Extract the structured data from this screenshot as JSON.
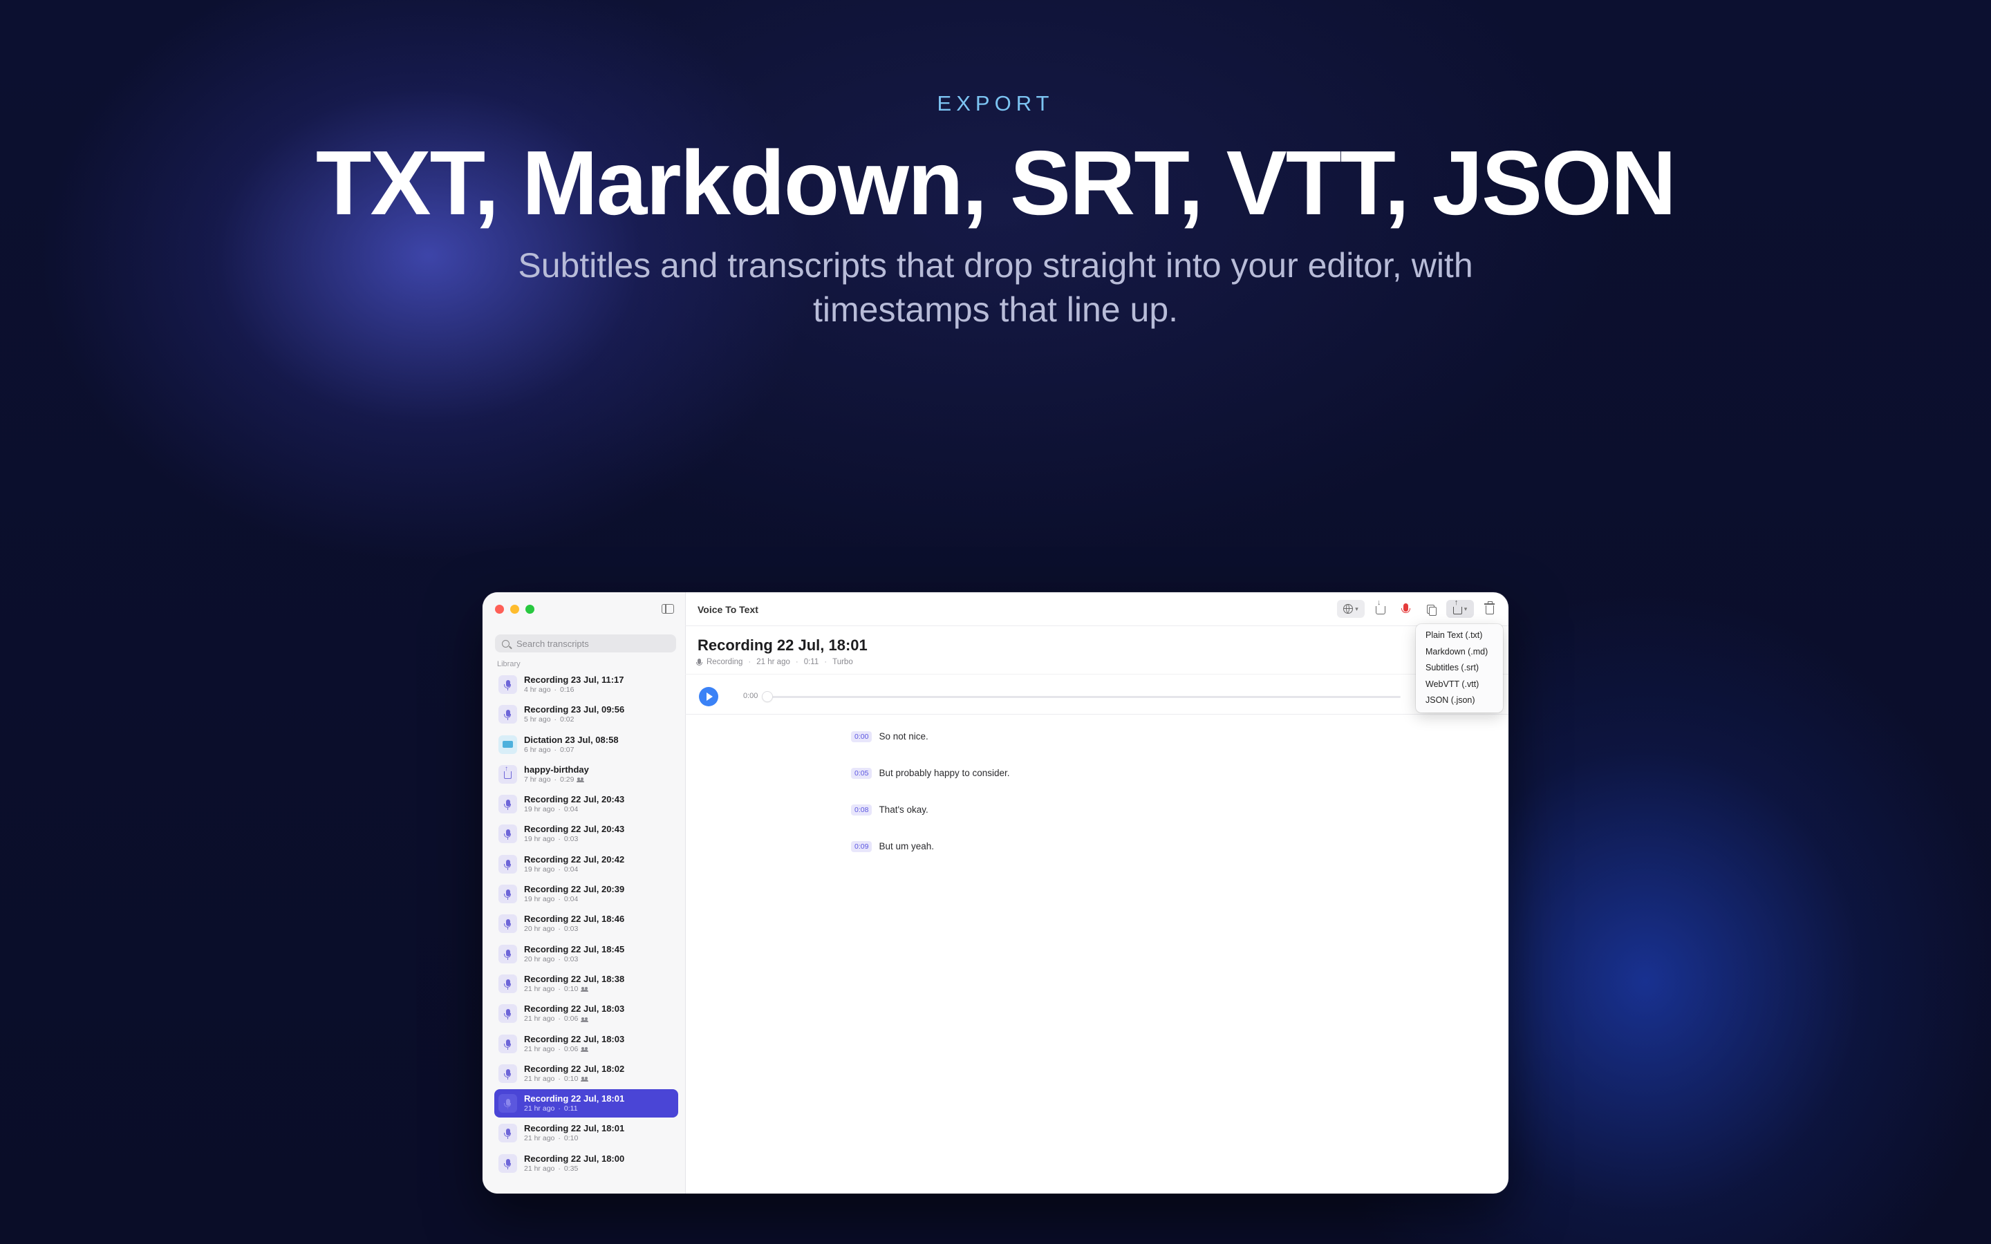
{
  "hero": {
    "eyebrow": "EXPORT",
    "headline": "TXT, Markdown, SRT, VTT, JSON",
    "subhead": "Subtitles and transcripts that drop straight into your editor, with timestamps that line up."
  },
  "sidebar": {
    "search_placeholder": "Search transcripts",
    "section_label": "Library",
    "items": [
      {
        "title": "Recording 23 Jul, 11:17",
        "ago": "4 hr ago",
        "duration": "0:16",
        "icon": "mic-icon",
        "speakers": false,
        "selected": false
      },
      {
        "title": "Recording 23 Jul, 09:56",
        "ago": "5 hr ago",
        "duration": "0:02",
        "icon": "mic-icon",
        "speakers": false,
        "selected": false
      },
      {
        "title": "Dictation 23 Jul, 08:58",
        "ago": "6 hr ago",
        "duration": "0:07",
        "icon": "keyboard-icon",
        "speakers": false,
        "selected": false
      },
      {
        "title": "happy-birthday",
        "ago": "7 hr ago",
        "duration": "0:29",
        "icon": "upload-icon",
        "speakers": true,
        "selected": false
      },
      {
        "title": "Recording 22 Jul, 20:43",
        "ago": "19 hr ago",
        "duration": "0:04",
        "icon": "mic-icon",
        "speakers": false,
        "selected": false
      },
      {
        "title": "Recording 22 Jul, 20:43",
        "ago": "19 hr ago",
        "duration": "0:03",
        "icon": "mic-icon",
        "speakers": false,
        "selected": false
      },
      {
        "title": "Recording 22 Jul, 20:42",
        "ago": "19 hr ago",
        "duration": "0:04",
        "icon": "mic-icon",
        "speakers": false,
        "selected": false
      },
      {
        "title": "Recording 22 Jul, 20:39",
        "ago": "19 hr ago",
        "duration": "0:04",
        "icon": "mic-icon",
        "speakers": false,
        "selected": false
      },
      {
        "title": "Recording 22 Jul, 18:46",
        "ago": "20 hr ago",
        "duration": "0:03",
        "icon": "mic-icon",
        "speakers": false,
        "selected": false
      },
      {
        "title": "Recording 22 Jul, 18:45",
        "ago": "20 hr ago",
        "duration": "0:03",
        "icon": "mic-icon",
        "speakers": false,
        "selected": false
      },
      {
        "title": "Recording 22 Jul, 18:38",
        "ago": "21 hr ago",
        "duration": "0:10",
        "icon": "mic-icon",
        "speakers": true,
        "selected": false
      },
      {
        "title": "Recording 22 Jul, 18:03",
        "ago": "21 hr ago",
        "duration": "0:06",
        "icon": "mic-icon",
        "speakers": true,
        "selected": false
      },
      {
        "title": "Recording 22 Jul, 18:03",
        "ago": "21 hr ago",
        "duration": "0:06",
        "icon": "mic-icon",
        "speakers": true,
        "selected": false
      },
      {
        "title": "Recording 22 Jul, 18:02",
        "ago": "21 hr ago",
        "duration": "0:10",
        "icon": "mic-icon",
        "speakers": true,
        "selected": false
      },
      {
        "title": "Recording 22 Jul, 18:01",
        "ago": "21 hr ago",
        "duration": "0:11",
        "icon": "mic-icon",
        "speakers": false,
        "selected": true
      },
      {
        "title": "Recording 22 Jul, 18:01",
        "ago": "21 hr ago",
        "duration": "0:10",
        "icon": "mic-icon",
        "speakers": false,
        "selected": false
      },
      {
        "title": "Recording 22 Jul, 18:00",
        "ago": "21 hr ago",
        "duration": "0:35",
        "icon": "mic-icon",
        "speakers": false,
        "selected": false
      }
    ]
  },
  "main": {
    "app_title": "Voice To Text",
    "recording_title": "Recording 22 Jul, 18:01",
    "meta": {
      "source": "Recording",
      "ago": "21 hr ago",
      "duration": "0:11",
      "model": "Turbo"
    },
    "player": {
      "time": "0:00",
      "progress": 0
    },
    "segments": [
      {
        "time": "0:00",
        "text": "So not nice."
      },
      {
        "time": "0:05",
        "text": "But probably happy to consider."
      },
      {
        "time": "0:08",
        "text": "That's okay."
      },
      {
        "time": "0:09",
        "text": "But um yeah."
      }
    ]
  },
  "export_menu": {
    "items": [
      "Plain Text (.txt)",
      "Markdown (.md)",
      "Subtitles (.srt)",
      "WebVTT (.vtt)",
      "JSON (.json)"
    ]
  },
  "colors": {
    "accent": "#4a45d6",
    "play": "#3b82f6",
    "eyebrow": "#7cc4f2",
    "record": "#e43b3b"
  }
}
